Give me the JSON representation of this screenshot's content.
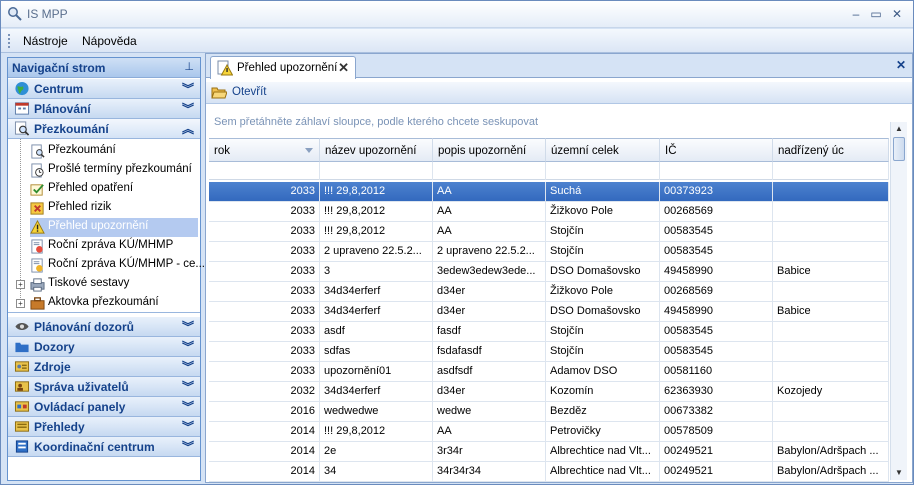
{
  "app": {
    "title": "IS MPP"
  },
  "menu": [
    "Nástroje",
    "Nápověda"
  ],
  "nav": {
    "title": "Navigační strom",
    "groups_top": [
      {
        "label": "Centrum",
        "icon": "globe-icon"
      },
      {
        "label": "Plánování",
        "icon": "calendar-icon"
      },
      {
        "label": "Přezkoumání",
        "icon": "magnifier-icon"
      }
    ],
    "tree": [
      {
        "label": "Přezkoumání",
        "icon": "review-icon"
      },
      {
        "label": "Prošlé termíny přezkoumání",
        "icon": "expired-icon"
      },
      {
        "label": "Přehled opatření",
        "icon": "measures-icon"
      },
      {
        "label": "Přehled rizik",
        "icon": "risk-icon"
      },
      {
        "label": "Přehled upozornění",
        "icon": "warning-icon"
      },
      {
        "label": "Roční zpráva KÚ/MHMP",
        "icon": "report-icon"
      },
      {
        "label": "Roční zpráva KÚ/MHMP - ce...",
        "icon": "report-icon"
      },
      {
        "label": "Tiskové sestavy",
        "icon": "print-icon"
      },
      {
        "label": "Aktovka přezkoumání",
        "icon": "briefcase-icon"
      }
    ],
    "groups_bottom": [
      {
        "label": "Plánování dozorů",
        "icon": "eye-icon"
      },
      {
        "label": "Dozory",
        "icon": "folder-icon"
      },
      {
        "label": "Zdroje",
        "icon": "resources-icon"
      },
      {
        "label": "Správa uživatelů",
        "icon": "users-icon"
      },
      {
        "label": "Ovládací panely",
        "icon": "panel-icon"
      },
      {
        "label": "Přehledy",
        "icon": "overview-icon"
      },
      {
        "label": "Koordinační centrum",
        "icon": "coordination-icon"
      }
    ]
  },
  "tab": {
    "label": "Přehled upozornění"
  },
  "toolbar": {
    "open_label": "Otevřít"
  },
  "grid": {
    "group_hint": "Sem přetáhněte záhlaví sloupce, podle kterého chcete seskupovat",
    "columns": [
      "rok",
      "název upozornění",
      "popis upozornění",
      "územní celek",
      "IČ",
      "nadřízený úc"
    ],
    "rows": [
      [
        "2033",
        "!!! 29,8,2012",
        "AA",
        "Suchá",
        "00373923",
        ""
      ],
      [
        "2033",
        "!!! 29,8,2012",
        "AA",
        "Žižkovo Pole",
        "00268569",
        ""
      ],
      [
        "2033",
        "!!! 29,8,2012",
        "AA",
        "Stojčín",
        "00583545",
        ""
      ],
      [
        "2033",
        "2 upraveno 22.5.2...",
        "2 upraveno 22.5.2...",
        "Stojčín",
        "00583545",
        ""
      ],
      [
        "2033",
        "3",
        "3edew3edew3ede...",
        "DSO Domašovsko",
        "49458990",
        "Babice"
      ],
      [
        "2033",
        "34d34erferf",
        "d34er",
        "Žižkovo Pole",
        "00268569",
        ""
      ],
      [
        "2033",
        "34d34erferf",
        "d34er",
        "DSO Domašovsko",
        "49458990",
        "Babice"
      ],
      [
        "2033",
        "asdf",
        "fasdf",
        "Stojčín",
        "00583545",
        ""
      ],
      [
        "2033",
        "sdfas",
        "fsdafasdf",
        "Stojčín",
        "00583545",
        ""
      ],
      [
        "2033",
        "upozornění01",
        "asdfsdf",
        "Adamov DSO",
        "00581160",
        ""
      ],
      [
        "2032",
        "34d34erferf",
        "d34er",
        "Kozomín",
        "62363930",
        "Kozojedy"
      ],
      [
        "2016",
        "wedwedwe",
        "wedwe",
        "Bezděz",
        "00673382",
        ""
      ],
      [
        "2014",
        "!!! 29,8,2012",
        "AA",
        "Petrovičky",
        "00578509",
        ""
      ],
      [
        "2014",
        "2e",
        "3r34r",
        "Albrechtice nad  Vlt...",
        "00249521",
        "Babylon/Adršpach ..."
      ],
      [
        "2014",
        "34",
        "34r34r34",
        "Albrechtice nad  Vlt...",
        "00249521",
        "Babylon/Adršpach ..."
      ]
    ]
  }
}
